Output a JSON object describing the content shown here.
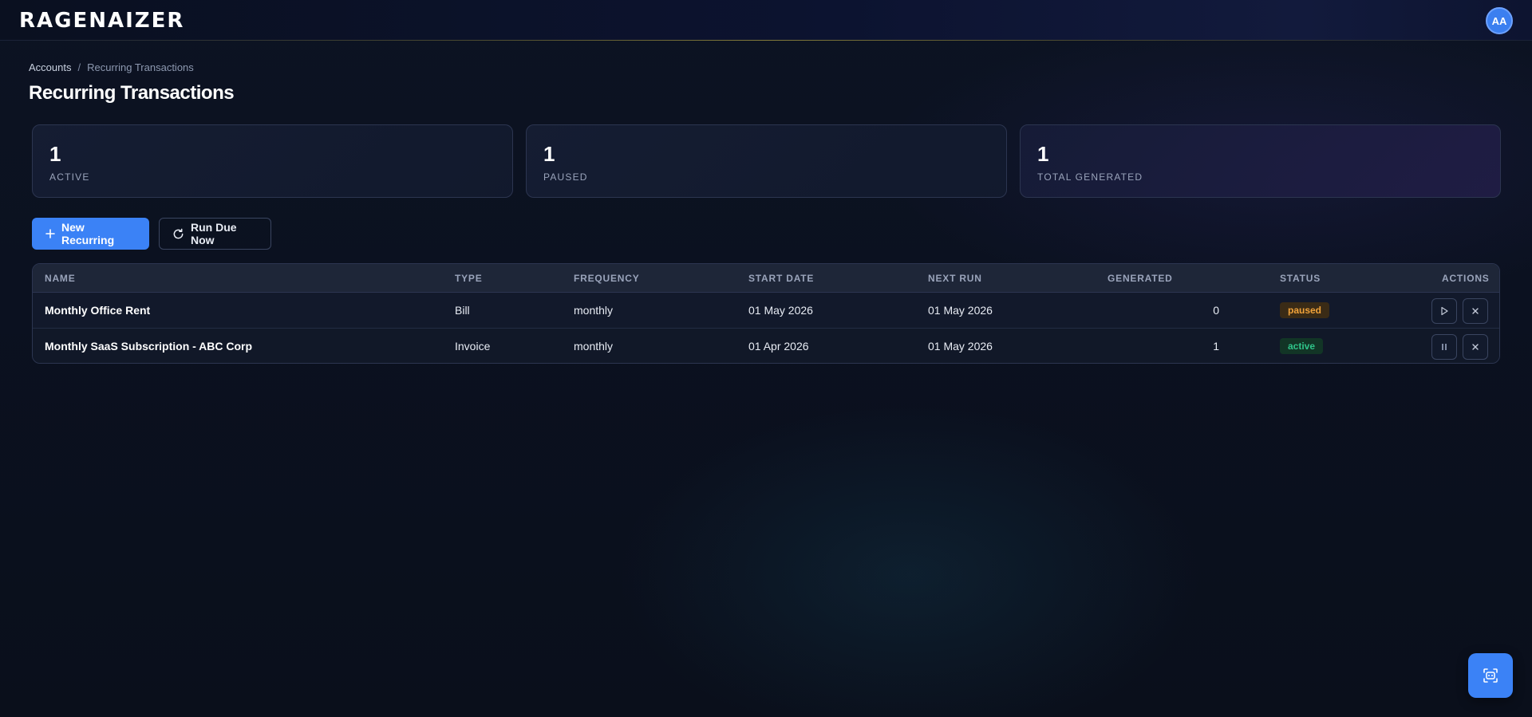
{
  "app": {
    "logo_text": "RAGENAIZER",
    "avatar_initials": "AA"
  },
  "breadcrumb": {
    "items": [
      "Accounts",
      "Recurring Transactions"
    ],
    "separator": "/"
  },
  "page": {
    "title": "Recurring Transactions"
  },
  "stats": [
    {
      "value": "1",
      "label": "ACTIVE"
    },
    {
      "value": "1",
      "label": "PAUSED"
    },
    {
      "value": "1",
      "label": "TOTAL GENERATED"
    }
  ],
  "toolbar": {
    "new_label": "New Recurring",
    "run_label": "Run Due Now"
  },
  "table": {
    "headers": [
      "NAME",
      "TYPE",
      "FREQUENCY",
      "START DATE",
      "NEXT RUN",
      "GENERATED",
      "STATUS",
      "ACTIONS"
    ],
    "rows": [
      {
        "name": "Monthly Office Rent",
        "type": "Bill",
        "frequency": "monthly",
        "start_date": "01 May 2026",
        "next_run": "01 May 2026",
        "generated": "0",
        "status": "paused",
        "actions": [
          "play-icon",
          "close-icon"
        ]
      },
      {
        "name": "Monthly SaaS Subscription - ABC Corp",
        "type": "Invoice",
        "frequency": "monthly",
        "start_date": "01 Apr 2026",
        "next_run": "01 May 2026",
        "generated": "1",
        "status": "active",
        "actions": [
          "pause-icon",
          "close-icon"
        ]
      }
    ]
  },
  "colors": {
    "accent": "#3b82f6",
    "paused_badge": "#f0a23a",
    "active_badge": "#2fc48a",
    "background": "#0b101c"
  },
  "fab": {
    "icon": "ai-chat-icon"
  }
}
